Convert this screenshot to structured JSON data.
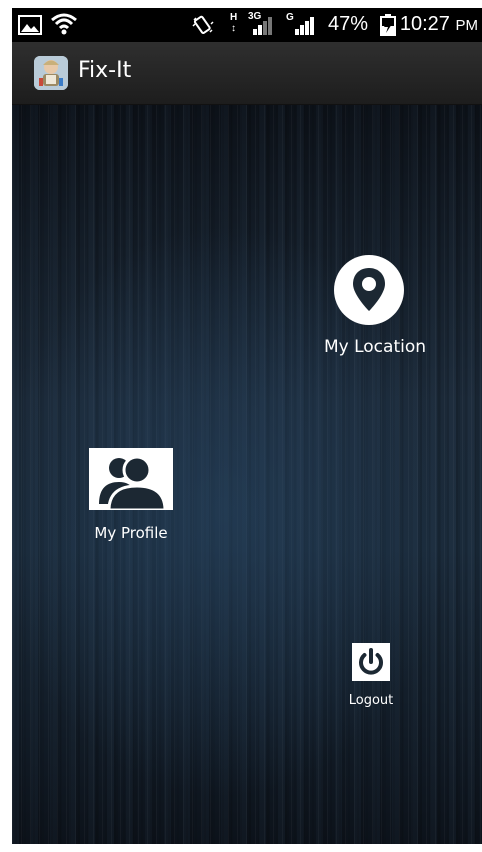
{
  "status_bar": {
    "network_3g": "3G",
    "network_g": "G",
    "network_h": "H",
    "battery_percent": "47%",
    "time": "10:27",
    "ampm": "PM",
    "icons": [
      "image-notification-icon",
      "wifi-icon",
      "vibrate-icon",
      "signal-icon",
      "battery-charging-icon"
    ]
  },
  "action_bar": {
    "title": "Fix-It",
    "icon": "app-logo-icon"
  },
  "menu": {
    "location": {
      "label": "My Location",
      "icon": "location-pin-icon"
    },
    "profile": {
      "label": "My Profile",
      "icon": "profile-users-icon"
    },
    "logout": {
      "label": "Logout",
      "icon": "power-icon"
    }
  },
  "colors": {
    "action_bar": "#262626",
    "background": "#16222f",
    "text": "#ffffff"
  }
}
